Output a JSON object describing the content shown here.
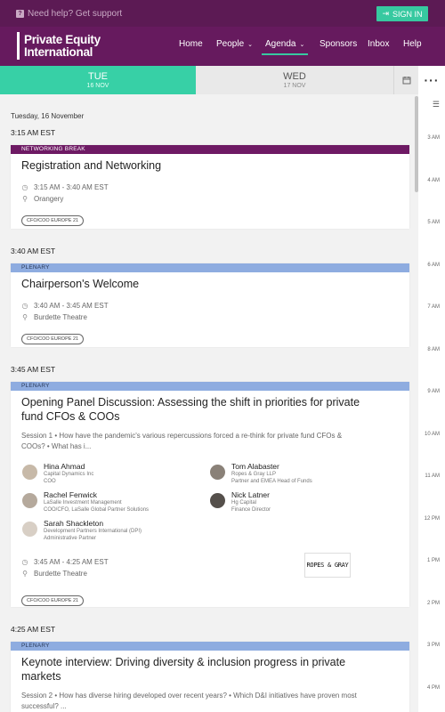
{
  "header": {
    "help_text": "Need help? Get support",
    "signin_label": "SIGN IN"
  },
  "nav": {
    "logo_line1": "Private Equity",
    "logo_line2": "International",
    "items": [
      "Home",
      "People",
      "Agenda",
      "Sponsors",
      "Inbox",
      "Help"
    ]
  },
  "days": [
    {
      "name": "TUE",
      "date": "16 NOV",
      "selected": true
    },
    {
      "name": "WED",
      "date": "17 NOV",
      "selected": false
    }
  ],
  "agenda": {
    "date_heading": "Tuesday, 16 November",
    "slots": [
      {
        "time": "3:15 AM EST",
        "sessions": [
          {
            "tag": "NETWORKING BREAK",
            "title": "Registration and Networking",
            "time_range": "3:15 AM - 3:40 AM EST",
            "location": "Orangery",
            "track": "CFO/COO EUROPE 21"
          }
        ]
      },
      {
        "time": "3:40 AM EST",
        "sessions": [
          {
            "tag": "PLENARY",
            "title": "Chairperson's Welcome",
            "time_range": "3:40 AM - 3:45 AM EST",
            "location": "Burdette Theatre",
            "track": "CFO/COO EUROPE 21"
          }
        ]
      },
      {
        "time": "3:45 AM EST",
        "sessions": [
          {
            "tag": "PLENARY",
            "title_line1": "Opening Panel Discussion: Assessing the shift in priorities for private",
            "title_line2": "fund CFOs & COOs",
            "desc_line1": "Session 1 • How have the pandemic's various repercussions forced a re-think for private fund CFOs &",
            "desc_line2": "COOs? • What has i...",
            "speakers": [
              {
                "name": "Hina Ahmad",
                "org": "Capital Dynamics Inc",
                "role": "COO"
              },
              {
                "name": "Tom Alabaster",
                "org": "Ropes & Gray LLP",
                "role": "Partner and EMEA Head of Funds"
              },
              {
                "name": "Rachel Fenwick",
                "org": "LaSalle Investment Management",
                "role": "COO/CFO, LaSalle Global Partner Solutions"
              },
              {
                "name": "Nick Latner",
                "org": "Hg Capital",
                "role": "Finance Director"
              },
              {
                "name": "Sarah Shackleton",
                "org": "Development Partners International (DPI)",
                "role": "Administrative Partner"
              }
            ],
            "time_range": "3:45 AM - 4:25 AM EST",
            "location": "Burdette Theatre",
            "track": "CFO/COO EUROPE 21",
            "sponsor_logo": "ROPES & GRAY"
          }
        ]
      },
      {
        "time": "4:25 AM EST",
        "sessions": [
          {
            "tag": "PLENARY",
            "title_line1": "Keynote interview: Driving diversity & inclusion progress in private",
            "title_line2": "markets",
            "desc_line1": "Session 2 • How has diverse hiring developed over recent years? • Which D&I initiatives have proven most",
            "desc_line2": "successful? ..."
          }
        ]
      }
    ]
  },
  "timeline_ticks": [
    "3 AM",
    "4 AM",
    "5 AM",
    "6 AM",
    "7 AM",
    "8 AM",
    "9 AM",
    "10 AM",
    "11 AM",
    "12 PM",
    "1 PM",
    "2 PM",
    "3 PM",
    "4 PM"
  ],
  "colors": {
    "purple": "#661a5e",
    "accent_green": "#37d0a6",
    "networking_tag": "#6e1a64",
    "plenary_tag": "#8eace0"
  }
}
